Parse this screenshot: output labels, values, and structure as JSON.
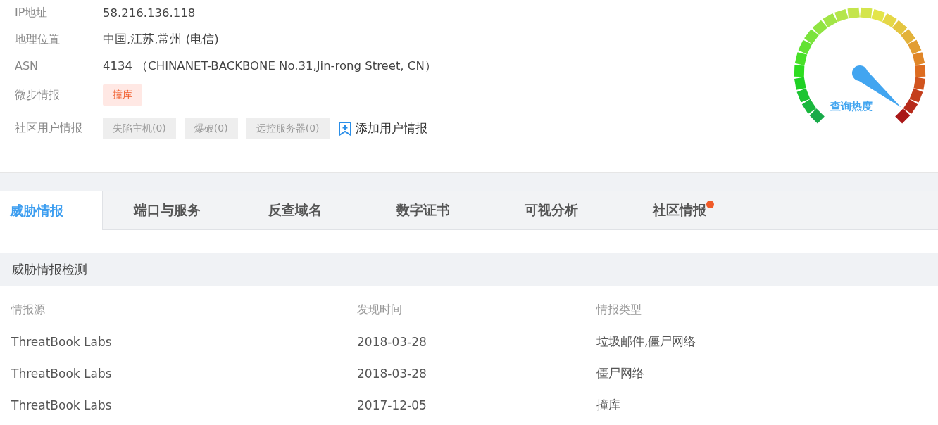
{
  "info": [
    {
      "label": "IP地址",
      "value": "58.216.136.118"
    },
    {
      "label": "地理位置",
      "value": "中国,江苏,常州 (电信)"
    },
    {
      "label": "ASN",
      "value": "4134 （CHINANET-BACKBONE No.31,Jin-rong Street, CN）"
    }
  ],
  "threat_intel": {
    "label": "微步情报",
    "tags": [
      "撞库"
    ]
  },
  "community": {
    "label": "社区用户情报",
    "tags": [
      "失陷主机(0)",
      "爆破(0)",
      "远控服务器(0)"
    ],
    "add_link": "添加用户情报"
  },
  "gauge": {
    "label": "查询热度"
  },
  "tabs": [
    {
      "label": "威胁情报",
      "selected": true,
      "dot": false
    },
    {
      "label": "端口与服务",
      "selected": false,
      "dot": false
    },
    {
      "label": "反查域名",
      "selected": false,
      "dot": false
    },
    {
      "label": "数字证书",
      "selected": false,
      "dot": false
    },
    {
      "label": "可视分析",
      "selected": false,
      "dot": false
    },
    {
      "label": "社区情报",
      "selected": false,
      "dot": true
    }
  ],
  "section": {
    "title": "威胁情报检测",
    "columns": [
      "情报源",
      "发现时间",
      "情报类型"
    ],
    "rows": [
      [
        "ThreatBook Labs",
        "2018-03-28",
        "垃圾邮件,僵尸网络"
      ],
      [
        "ThreatBook Labs",
        "2018-03-28",
        "僵尸网络"
      ],
      [
        "ThreatBook Labs",
        "2017-12-05",
        "撞库"
      ]
    ]
  }
}
